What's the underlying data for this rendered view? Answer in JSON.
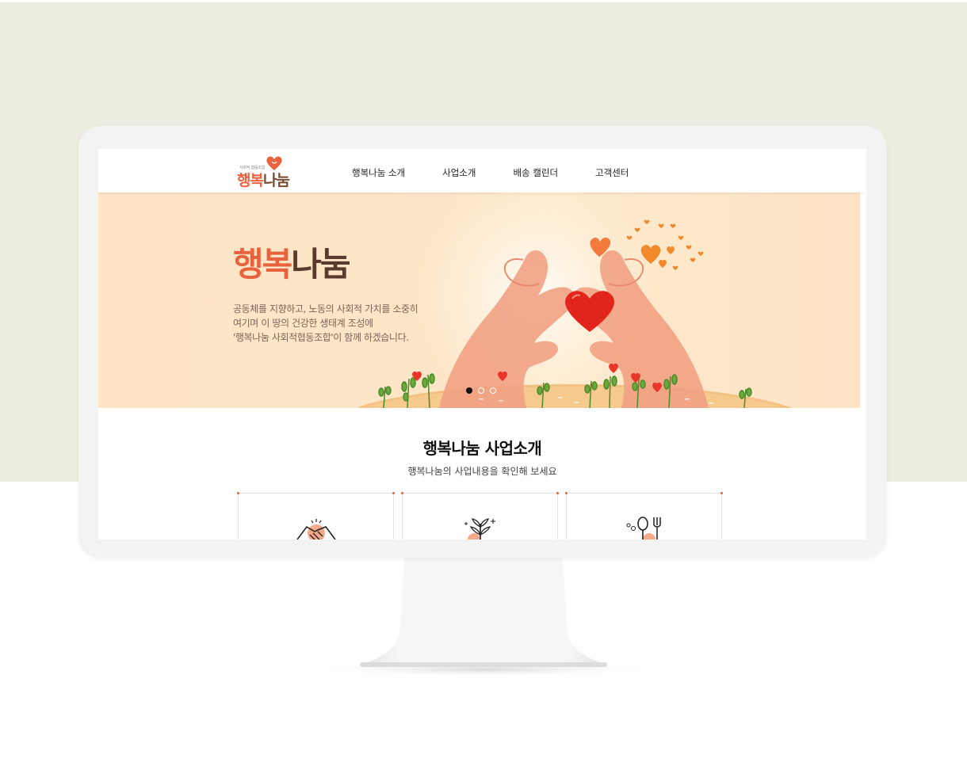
{
  "header": {
    "logo_subtitle": "사회적 협동조합",
    "logo_part1": "행복",
    "logo_part2": "나눔"
  },
  "nav": {
    "items": [
      {
        "label": "행복나눔 소개"
      },
      {
        "label": "사업소개"
      },
      {
        "label": "배송 캘린더"
      },
      {
        "label": "고객센터"
      }
    ]
  },
  "banner": {
    "title_part1": "행복",
    "title_part2": "나눔",
    "lines": [
      "공동체를 지향하고, 노동의 사회적 가치를 소중히",
      "여기며 이 땅의 건강한 생태계 조성에",
      "'행복나눔 사회적협동조합'이 함께 하겠습니다."
    ],
    "slides": 3,
    "active_slide": 1
  },
  "section": {
    "title": "행복나눔 사업소개",
    "subtitle": "행복나눔의 사업내용을 확인해 보세요",
    "cards": [
      {
        "icon": "handshake-icon"
      },
      {
        "icon": "plant-icon"
      },
      {
        "icon": "utensils-icon"
      }
    ]
  },
  "colors": {
    "accent": "#e8633d",
    "background_top": "#ecece0",
    "banner_bg": "#fde5c6"
  }
}
